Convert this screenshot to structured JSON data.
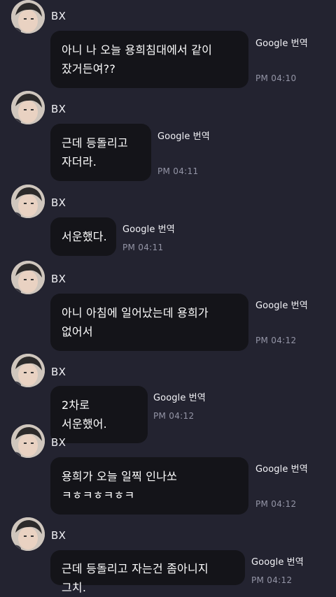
{
  "translate_label": "Google 번역",
  "messages": [
    {
      "sender": "BX",
      "text": "아니 나 오늘 용희침대에서 같이 잤거든여??",
      "time": "PM 04:10"
    },
    {
      "sender": "BX",
      "text": "근데 등돌리고 자더라.",
      "time": "PM 04:11"
    },
    {
      "sender": "BX",
      "text": "서운했다.",
      "time": "PM 04:11"
    },
    {
      "sender": "BX",
      "text": "아니 아침에 일어났는데 용희가 없어서",
      "time": "PM 04:12"
    },
    {
      "sender": "BX",
      "text": "2차로 서운했어.",
      "time": "PM 04:12"
    },
    {
      "sender": "BX",
      "text": "용희가 오늘 일찍 인나쏘 ㅋㅎㅋㅎㅋㅎㅋ",
      "time": "PM 04:12"
    },
    {
      "sender": "BX",
      "text": "근데 등돌리고 자는건 좀아니지 그치.",
      "time": "PM 04:12"
    }
  ],
  "colors": {
    "background": "#232330",
    "bubble": "#141419",
    "time": "#9495a6"
  }
}
